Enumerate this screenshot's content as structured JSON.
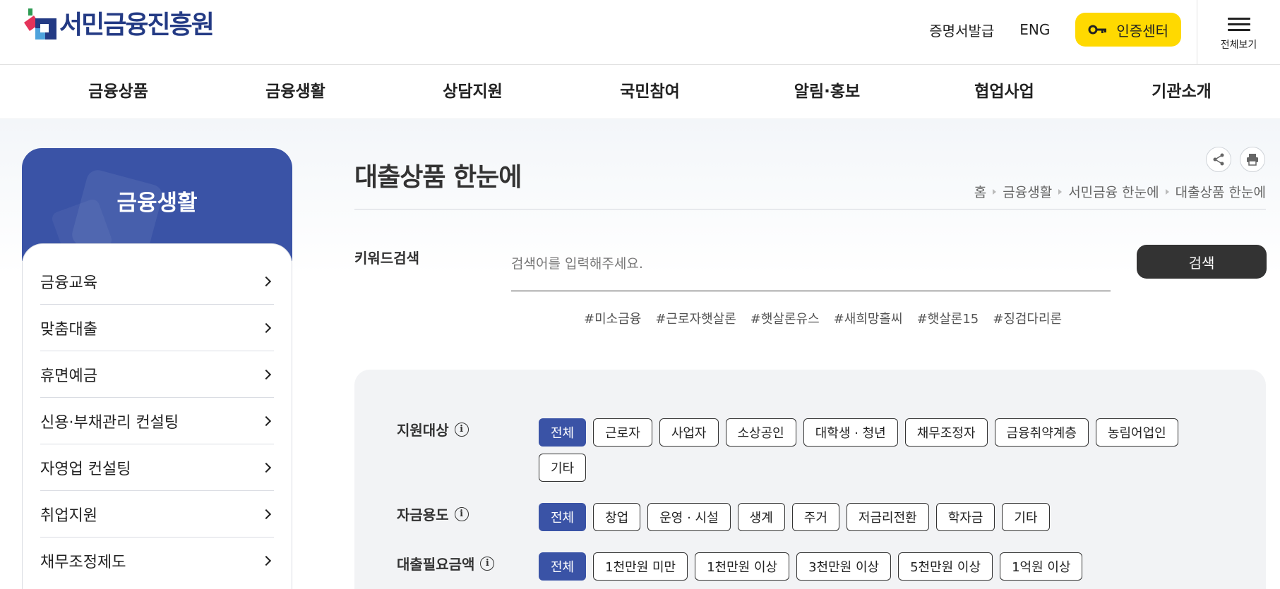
{
  "header": {
    "logo_text": "서민금융진흥원",
    "util_links": [
      "증명서발급",
      "ENG"
    ],
    "cert_center": "인증센터",
    "all_menu": "전체보기"
  },
  "gnb": [
    "금융상품",
    "금융생활",
    "상담지원",
    "국민참여",
    "알림·홍보",
    "협업사업",
    "기관소개"
  ],
  "sidebar": {
    "title": "금융생활",
    "items": [
      "금융교육",
      "맞춤대출",
      "휴면예금",
      "신용·부채관리 컨설팅",
      "자영업 컨설팅",
      "취업지원",
      "채무조정제도"
    ]
  },
  "main": {
    "title": "대출상품 한눈에",
    "breadcrumb": [
      "홈",
      "금융생활",
      "서민금융 한눈에",
      "대출상품 한눈에"
    ],
    "keyword_label": "키워드검색",
    "search_placeholder": "검색어를 입력해주세요.",
    "search_button": "검색",
    "tags": [
      "#미소금융",
      "#근로자햇살론",
      "#햇살론유스",
      "#새희망홀씨",
      "#햇살론15",
      "#징검다리론"
    ]
  },
  "filters": [
    {
      "label": "지원대상",
      "options": [
        "전체",
        "근로자",
        "사업자",
        "소상공인",
        "대학생 · 청년",
        "채무조정자",
        "금융취약계층",
        "농림어업인",
        "기타"
      ],
      "selected": "전체"
    },
    {
      "label": "자금용도",
      "options": [
        "전체",
        "창업",
        "운영 · 시설",
        "생계",
        "주거",
        "저금리전환",
        "학자금",
        "기타"
      ],
      "selected": "전체"
    },
    {
      "label": "대출필요금액",
      "options": [
        "전체",
        "1천만원 미만",
        "1천만원 이상",
        "3천만원 이상",
        "5천만원 이상",
        "1억원 이상"
      ],
      "selected": "전체"
    }
  ],
  "colors": {
    "brand": "#3a53a6",
    "cert_yellow": "#ffd900",
    "dark_button": "#333333"
  },
  "icons": {
    "info": "i"
  }
}
